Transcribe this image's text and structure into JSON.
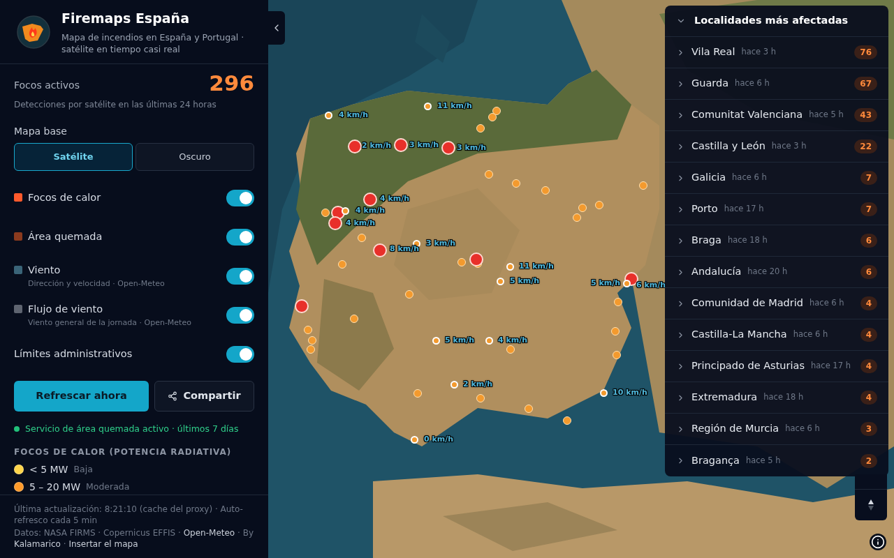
{
  "header": {
    "title": "Firemaps España",
    "subtitle": "Mapa de incendios en España y Portugal · satélite en tiempo casi real"
  },
  "stats": {
    "label": "Focos activos",
    "value": "296",
    "caption": "Detecciones por satélite en las últimas 24 horas"
  },
  "basemap": {
    "label": "Mapa base",
    "options": [
      {
        "label": "Satélite",
        "selected": true
      },
      {
        "label": "Oscuro",
        "selected": false
      }
    ]
  },
  "layers": [
    {
      "kind": "swatch",
      "label": "Focos de calor",
      "color": "#ff5a2c",
      "on": true
    },
    {
      "kind": "swatch",
      "label": "Área quemada",
      "color": "#8a3a1e",
      "on": true
    },
    {
      "kind": "swatch",
      "label": "Viento",
      "subtitle": "Dirección y velocidad · Open-Meteo",
      "color": "#3a6478",
      "on": true
    },
    {
      "kind": "swatch",
      "label": "Flujo de viento",
      "subtitle": "Viento general de la jornada · Open-Meteo",
      "color": "#5e6470",
      "on": true
    },
    {
      "kind": "plain",
      "label": "Límites administrativos",
      "on": true
    }
  ],
  "actions": {
    "refresh": "Refrescar ahora",
    "share": "Compartir"
  },
  "service_status": {
    "text": "Servicio de área quemada activo · últimos 7 días",
    "color": "#22c07a"
  },
  "legend": {
    "title": "FOCOS DE CALOR (POTENCIA RADIATIVA)",
    "items": [
      {
        "range": "< 5 MW",
        "level": "Baja",
        "color": "#ffd54a"
      },
      {
        "range": "5 – 20 MW",
        "level": "Moderada",
        "color": "#ff9a2a"
      }
    ]
  },
  "footer": {
    "update": "Última actualización: 8:21:10 (cache del proxy) · Auto-refresco cada 5 min",
    "sources": [
      {
        "kind": "text",
        "text": "Datos: NASA FIRMS · Copernicus EFFIS ·"
      },
      {
        "kind": "link",
        "text": "Open-Meteo"
      },
      {
        "kind": "text",
        "text": "· By"
      },
      {
        "kind": "link",
        "text": "Kalamarico"
      },
      {
        "kind": "text",
        "text": "·"
      },
      {
        "kind": "link",
        "text": "Insertar el mapa"
      }
    ]
  },
  "map": {
    "wind_labels": [
      "4 km/h",
      "11 km/h",
      "2 km/h",
      "3 km/h",
      "3 km/h",
      "4 km/h",
      "4 km/h",
      "4 km/h",
      "3 km/h",
      "8 km/h",
      "11 km/h",
      "5 km/h",
      "5 km/h",
      "6 km/h",
      "5 km/h",
      "4 km/h",
      "2 km/h",
      "10 km/h",
      "0 km/h"
    ]
  },
  "panel": {
    "title": "Localidades más afectadas",
    "expanded": true,
    "items": [
      {
        "name": "Vila Real",
        "time": "hace 3 h",
        "count": "76"
      },
      {
        "name": "Guarda",
        "time": "hace 6 h",
        "count": "67"
      },
      {
        "name": "Comunitat Valenciana",
        "time": "hace 5 h",
        "count": "43"
      },
      {
        "name": "Castilla y León",
        "time": "hace 3 h",
        "count": "22"
      },
      {
        "name": "Galicia",
        "time": "hace 6 h",
        "count": "7"
      },
      {
        "name": "Porto",
        "time": "hace 17 h",
        "count": "7"
      },
      {
        "name": "Braga",
        "time": "hace 18 h",
        "count": "6"
      },
      {
        "name": "Andalucía",
        "time": "hace 20 h",
        "count": "6"
      },
      {
        "name": "Comunidad de Madrid",
        "time": "hace 6 h",
        "count": "4"
      },
      {
        "name": "Castilla-La Mancha",
        "time": "hace 6 h",
        "count": "4"
      },
      {
        "name": "Principado de Asturias",
        "time": "hace 17 h",
        "count": "4"
      },
      {
        "name": "Extremadura",
        "time": "hace 18 h",
        "count": "4"
      },
      {
        "name": "Región de Murcia",
        "time": "hace 6 h",
        "count": "3"
      },
      {
        "name": "Bragança",
        "time": "hace 5 h",
        "count": "2"
      }
    ]
  }
}
